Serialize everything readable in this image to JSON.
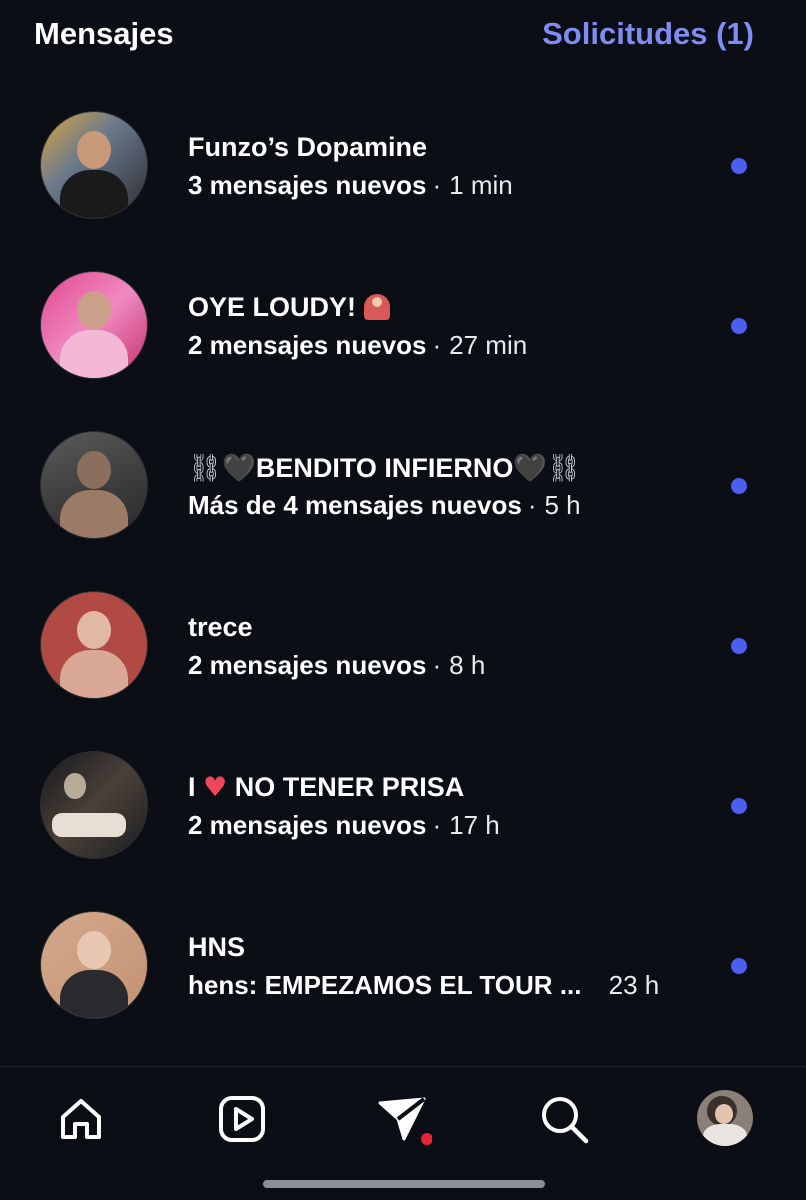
{
  "header": {
    "title": "Mensajes",
    "requests": "Solicitudes (1)"
  },
  "threads": [
    {
      "name": "Funzo’s Dopamine",
      "status": "3 mensajes nuevos",
      "time": "1 min",
      "unread": true
    },
    {
      "name": "OYE LOUDY! ",
      "name_emoji": "person-gesturing-no-emoji",
      "status": "2 mensajes nuevos",
      "time": "27 min",
      "unread": true
    },
    {
      "name_prefix": "⛓",
      "name_heart": "🖤",
      "name": "BENDITO INFIERNO",
      "name_suffix_heart": "🖤",
      "name_suffix": "⛓",
      "status": "Más de 4 mensajes nuevos",
      "time": "5 h",
      "unread": true
    },
    {
      "name": "trece",
      "status": "2 mensajes nuevos",
      "time": "8 h",
      "unread": true
    },
    {
      "name_prefix": "I ",
      "name_heart": "♥",
      "name": " NO TENER PRISA",
      "status": "2 mensajes nuevos",
      "time": "17 h",
      "unread": true
    },
    {
      "name": "HNS",
      "status": "hens: EMPEZAMOS EL TOUR ...",
      "time": "23 h",
      "unread": true
    }
  ],
  "nav": {
    "items": [
      "home-icon",
      "reels-icon",
      "messages-icon",
      "search-icon",
      "profile-avatar"
    ],
    "active": "messages-icon",
    "unread_color": "#e8243b"
  },
  "colors": {
    "background": "#0b0e14",
    "accent": "#7f8cf2",
    "unread_dot": "#4d5df0"
  }
}
